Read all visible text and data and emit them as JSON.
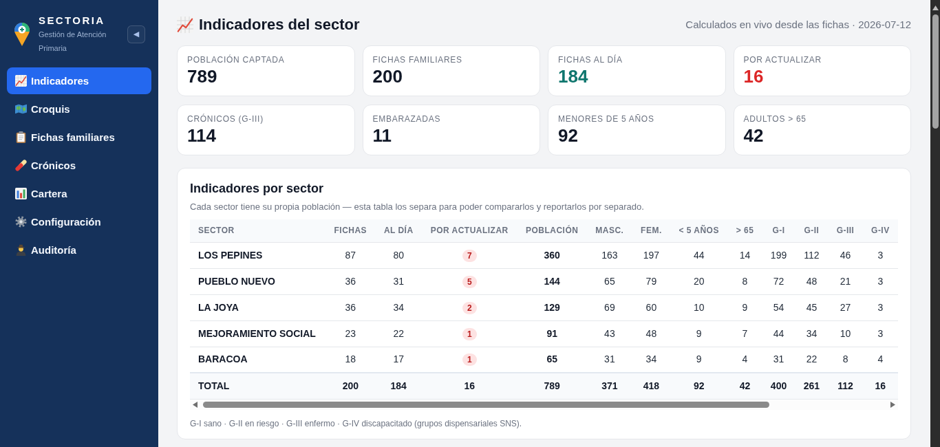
{
  "sidebar": {
    "brand": {
      "title": "SECTORIA",
      "subtitle": "Gestión de Atención Primaria"
    },
    "collapse_button": {
      "label": "◀"
    },
    "items": [
      {
        "label": "Indicadores",
        "selected": true
      },
      {
        "label": "Croquis",
        "selected": false
      },
      {
        "label": "Fichas familiares",
        "selected": false
      },
      {
        "label": "Crónicos",
        "selected": false
      },
      {
        "label": "Cartera",
        "selected": false
      },
      {
        "label": "Configuración",
        "selected": false
      },
      {
        "label": "Auditoría",
        "selected": false
      }
    ]
  },
  "header": {
    "title": "Indicadores del sector",
    "subtitle": "Calculados en vivo desde las fichas · 2026-07-12"
  },
  "stats": [
    {
      "label": "POBLACIÓN CAPTADA",
      "value": "789",
      "color": "#111827"
    },
    {
      "label": "FICHAS FAMILIARES",
      "value": "200",
      "color": "#111827"
    },
    {
      "label": "FICHAS AL DÍA",
      "value": "184",
      "color": "#0f766e"
    },
    {
      "label": "POR ACTUALIZAR",
      "value": "16",
      "color": "#dc2626"
    },
    {
      "label": "CRÓNICOS (G-III)",
      "value": "114",
      "color": "#111827"
    },
    {
      "label": "EMBARAZADAS",
      "value": "11",
      "color": "#111827"
    },
    {
      "label": "MENORES DE 5 AÑOS",
      "value": "92",
      "color": "#111827"
    },
    {
      "label": "ADULTOS > 65",
      "value": "42",
      "color": "#111827"
    }
  ],
  "table_card": {
    "title": "Indicadores por sector",
    "description": "Cada sector tiene su propia población — esta tabla los separa para poder compararlos y reportarlos por separado.",
    "table": {
      "columns": [
        {
          "label": "SECTOR",
          "kind": "name"
        },
        {
          "label": "FICHAS",
          "kind": "plain"
        },
        {
          "label": "AL DÍA",
          "kind": "plain"
        },
        {
          "label": "POR ACTUALIZAR",
          "kind": "badge"
        },
        {
          "label": "POBLACIÓN",
          "kind": "bold"
        },
        {
          "label": "MASC.",
          "kind": "plain"
        },
        {
          "label": "FEM.",
          "kind": "plain"
        },
        {
          "label": "< 5 AÑOS",
          "kind": "plain"
        },
        {
          "label": "> 65",
          "kind": "plain"
        },
        {
          "label": "G-I",
          "kind": "plain"
        },
        {
          "label": "G-II",
          "kind": "plain"
        },
        {
          "label": "G-III",
          "kind": "plain"
        },
        {
          "label": "G-IV",
          "kind": "plain"
        }
      ],
      "rows": [
        {
          "kind": "sector",
          "cells": [
            "LOS PEPINES",
            "87",
            "80",
            "7",
            "360",
            "163",
            "197",
            "44",
            "14",
            "199",
            "112",
            "46",
            "3"
          ]
        },
        {
          "kind": "sector",
          "cells": [
            "PUEBLO NUEVO",
            "36",
            "31",
            "5",
            "144",
            "65",
            "79",
            "20",
            "8",
            "72",
            "48",
            "21",
            "3"
          ]
        },
        {
          "kind": "sector",
          "cells": [
            "LA JOYA",
            "36",
            "34",
            "2",
            "129",
            "69",
            "60",
            "10",
            "9",
            "54",
            "45",
            "27",
            "3"
          ]
        },
        {
          "kind": "sector",
          "cells": [
            "MEJORAMIENTO SOCIAL",
            "23",
            "22",
            "1",
            "91",
            "43",
            "48",
            "9",
            "7",
            "44",
            "34",
            "10",
            "3"
          ]
        },
        {
          "kind": "sector",
          "cells": [
            "BARACOA",
            "18",
            "17",
            "1",
            "65",
            "31",
            "34",
            "9",
            "4",
            "31",
            "22",
            "8",
            "4"
          ]
        },
        {
          "kind": "total",
          "cells": [
            "TOTAL",
            "200",
            "184",
            "16",
            "789",
            "371",
            "418",
            "92",
            "42",
            "400",
            "261",
            "112",
            "16"
          ]
        }
      ]
    },
    "footnote": "G-I sano · G-II en riesgo · G-III enfermo · G-IV discapacitado (grupos dispensariales SNS)."
  }
}
